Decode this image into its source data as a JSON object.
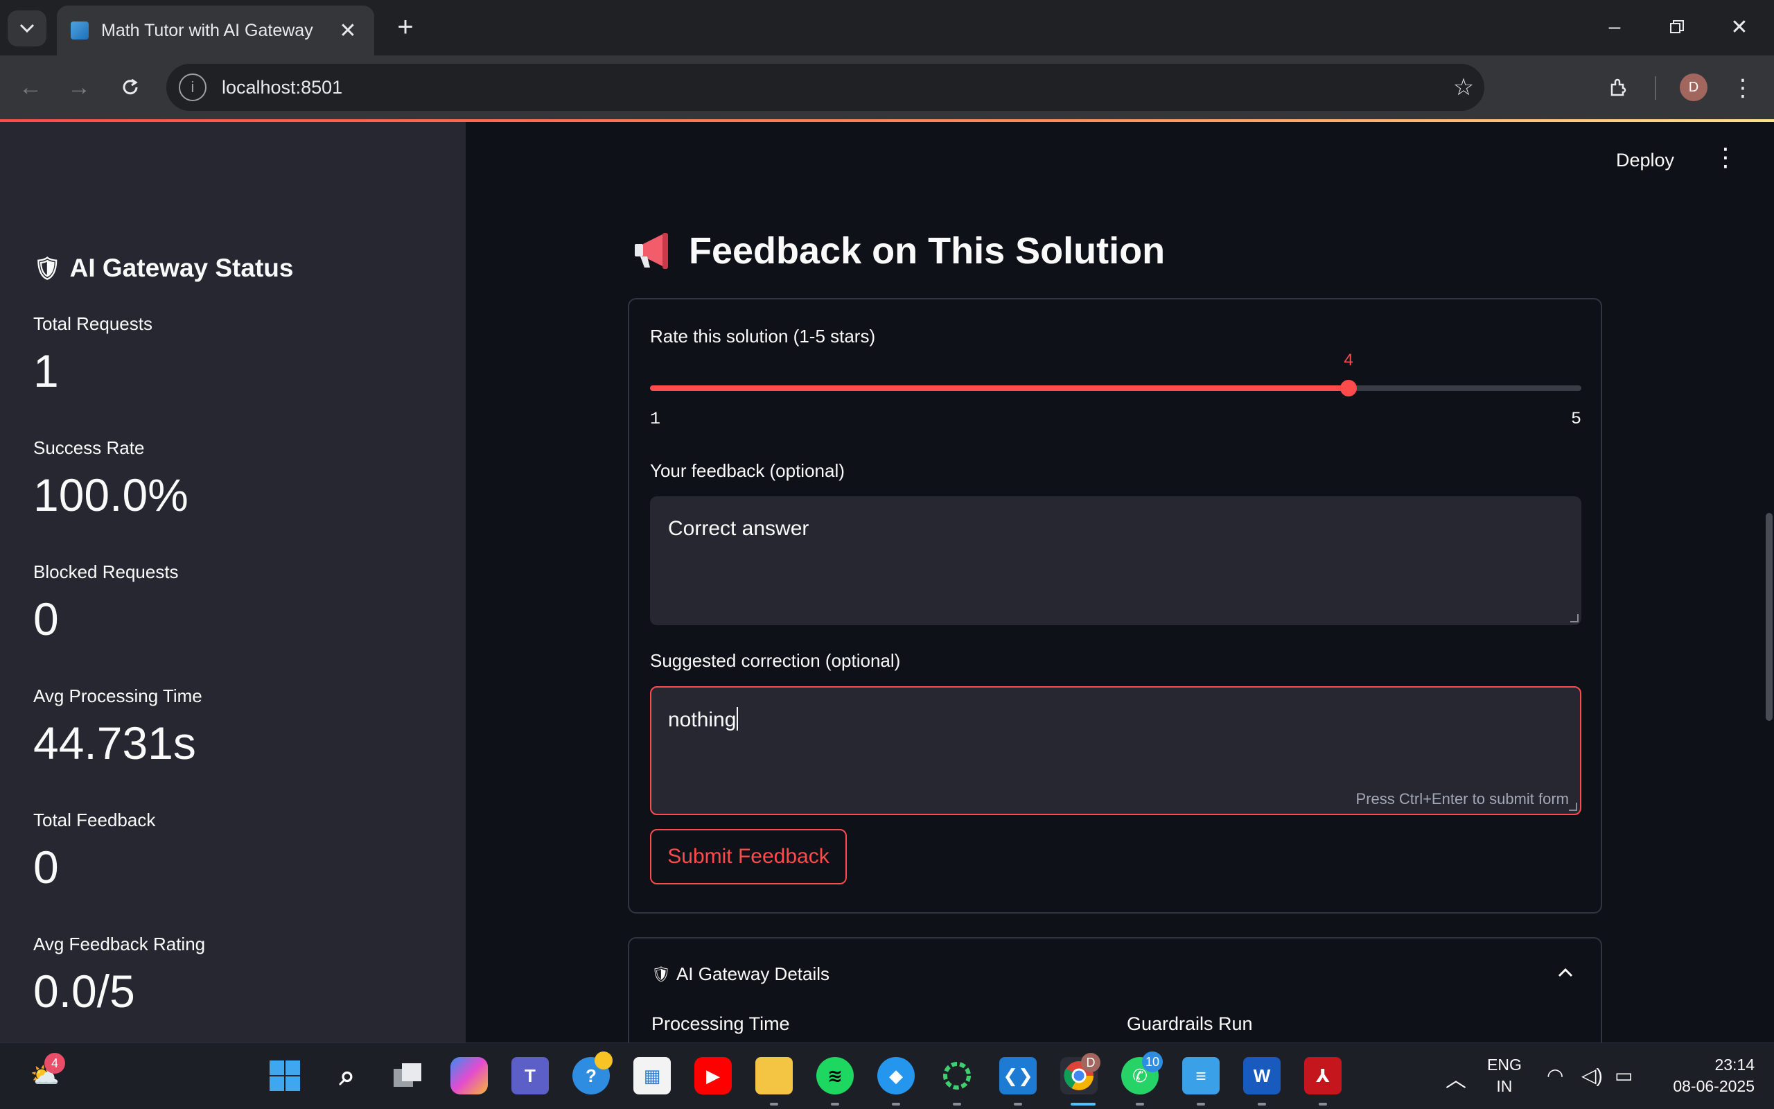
{
  "browser": {
    "tab_title": "Math Tutor with AI Gateway",
    "url": "localhost:8501",
    "profile_initial": "D"
  },
  "sidebar": {
    "title": "AI Gateway Status",
    "metrics": [
      {
        "label": "Total Requests",
        "value": "1"
      },
      {
        "label": "Success Rate",
        "value": "100.0%"
      },
      {
        "label": "Blocked Requests",
        "value": "0"
      },
      {
        "label": "Avg Processing Time",
        "value": "44.731s"
      },
      {
        "label": "Total Feedback",
        "value": "0"
      },
      {
        "label": "Avg Feedback Rating",
        "value": "0.0/5"
      }
    ]
  },
  "main": {
    "deploy_label": "Deploy",
    "heading": "Feedback on This Solution",
    "rating": {
      "label": "Rate this solution (1-5 stars)",
      "min": "1",
      "max": "5",
      "value": "4",
      "fraction": 0.75
    },
    "feedback": {
      "label": "Your feedback (optional)",
      "value": "Correct answer"
    },
    "correction": {
      "label": "Suggested correction (optional)",
      "value": "nothing",
      "hint": "Press Ctrl+Enter to submit form"
    },
    "submit_label": "Submit Feedback",
    "details": {
      "title": "AI Gateway Details",
      "col1": "Processing Time",
      "col2": "Guardrails Run"
    }
  },
  "taskbar": {
    "weather_badge": "4",
    "whatsapp_badge": "10",
    "chrome_profile": "D",
    "lang_top": "ENG",
    "lang_bottom": "IN",
    "time": "23:14",
    "date": "08-06-2025"
  },
  "colors": {
    "accent": "#ff4b4b",
    "sidebar_bg": "#262730",
    "main_bg": "#0e1117"
  }
}
